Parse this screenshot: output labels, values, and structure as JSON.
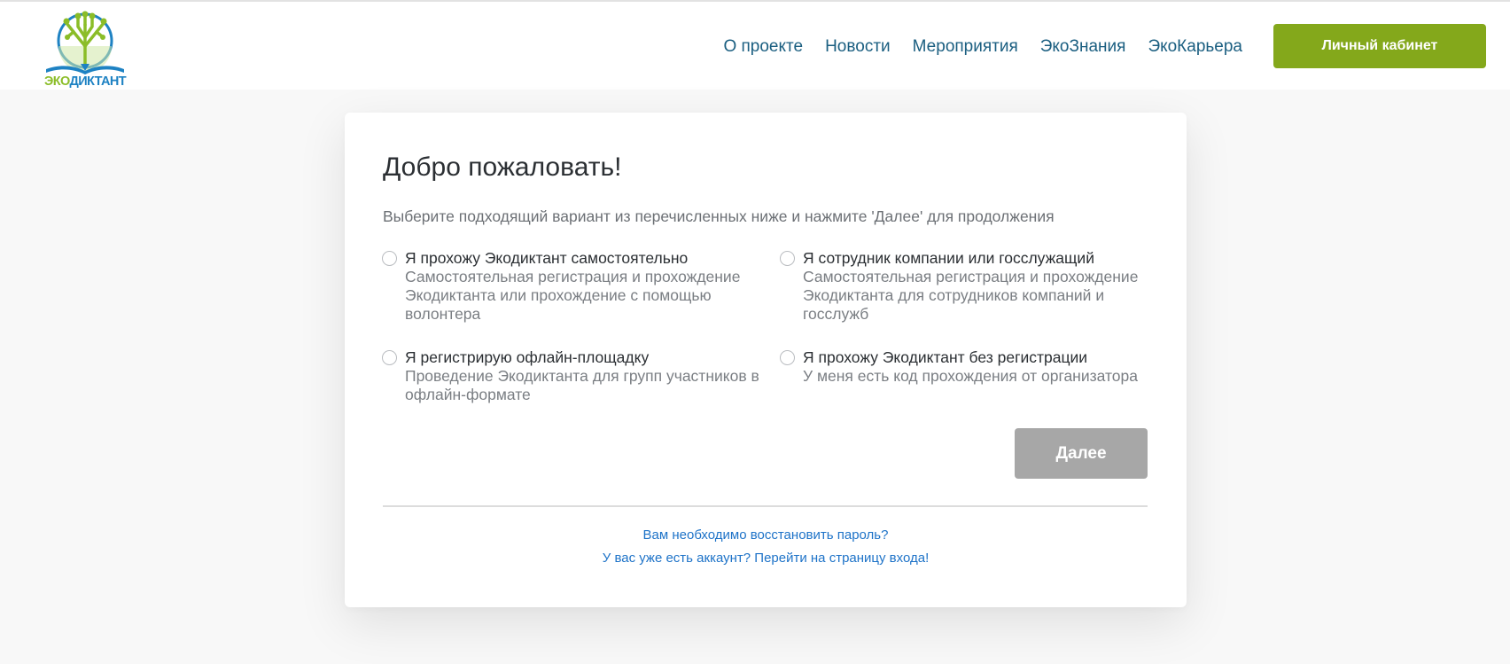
{
  "header": {
    "logo_text_part1": "ЭКО",
    "logo_text_part2": "ДИКТАНТ",
    "nav": [
      {
        "label": "О проекте"
      },
      {
        "label": "Новости"
      },
      {
        "label": "Мероприятия"
      },
      {
        "label": "ЭкоЗнания"
      },
      {
        "label": "ЭкоКарьера"
      }
    ],
    "cabinet_label": "Личный кабинет"
  },
  "card": {
    "title": "Добро пожаловать!",
    "subtitle": "Выберите подходящий вариант из перечисленных ниже и нажмите 'Далее' для продолжения",
    "options": [
      {
        "title": "Я прохожу Экодиктант самостоятельно",
        "desc": "Самостоятельная регистрация и прохождение Экодиктанта или прохождение с помощью волонтера",
        "selected": false
      },
      {
        "title": "Я сотрудник компании или госслужащий",
        "desc": "Самостоятельная регистрация и прохождение Экодиктанта для сотрудников компаний и госслужб",
        "selected": false
      },
      {
        "title": "Я регистрирую офлайн-площадку",
        "desc": "Проведение Экодиктанта для групп участников в офлайн-формате",
        "selected": false
      },
      {
        "title": "Я прохожу Экодиктант без регистрации",
        "desc": "У меня есть код прохождения от организатора",
        "selected": false
      }
    ],
    "next_label": "Далее",
    "links": {
      "restore_password": "Вам необходимо восстановить пароль?",
      "login": "У вас уже есть аккаунт? Перейти на страницу входа!"
    }
  },
  "colors": {
    "brand_green": "#84a81b",
    "nav_text": "#1a5e80",
    "link_blue": "#1e73c8",
    "disabled_button": "#a7a7a7",
    "logo_blue": "#1e82c3",
    "logo_green": "#8bbd28"
  },
  "icons": {
    "logo": "tree-book-logo-icon",
    "radio": "radio-unchecked-icon"
  }
}
